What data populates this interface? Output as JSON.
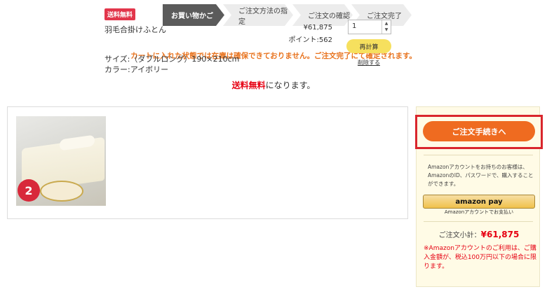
{
  "steps": [
    {
      "label": "お買い物かご",
      "active": true
    },
    {
      "label": "ご注文方法の指定",
      "active": false
    },
    {
      "label": "ご注文の確認",
      "active": false
    },
    {
      "label": "ご注文完了",
      "active": false
    }
  ],
  "notice": "カートに入れた状態では在庫は確保できておりません。ご注文完了にて確定されます。",
  "shipping": {
    "free_label": "送料無料",
    "suffix": "になります。"
  },
  "cart": {
    "item": {
      "tag": "送料無料",
      "name": "羽毛合掛けふとん",
      "image_badge": "2",
      "size": "サイズ:（ダブルロング）190×210cm",
      "color": "カラー:アイボリー",
      "price": "¥61,875",
      "points": "ポイント:562",
      "quantity": "1",
      "recalc_label": "再計算",
      "delete_label": "削除する"
    }
  },
  "sidebar": {
    "order_button": "ご注文手続きへ",
    "amazon_text": "Amazonアカウントをお持ちのお客様は、AmazonのID、パスワードで、購入することができます。",
    "amazon_pay_label": "amazon pay",
    "amazon_pay_sub": "Amazonアカウントでお支払い",
    "subtotal_label": "ご注文小計：",
    "subtotal_value": "¥61,875",
    "warning": "※Amazonアカウントのご利用は、ご購入金額が、税込100万円以下の場合に限ります。"
  },
  "colors": {
    "accent": "#ef6b20",
    "highlight": "#d9262d",
    "notice": "#e8731e",
    "free": "#e60012"
  }
}
